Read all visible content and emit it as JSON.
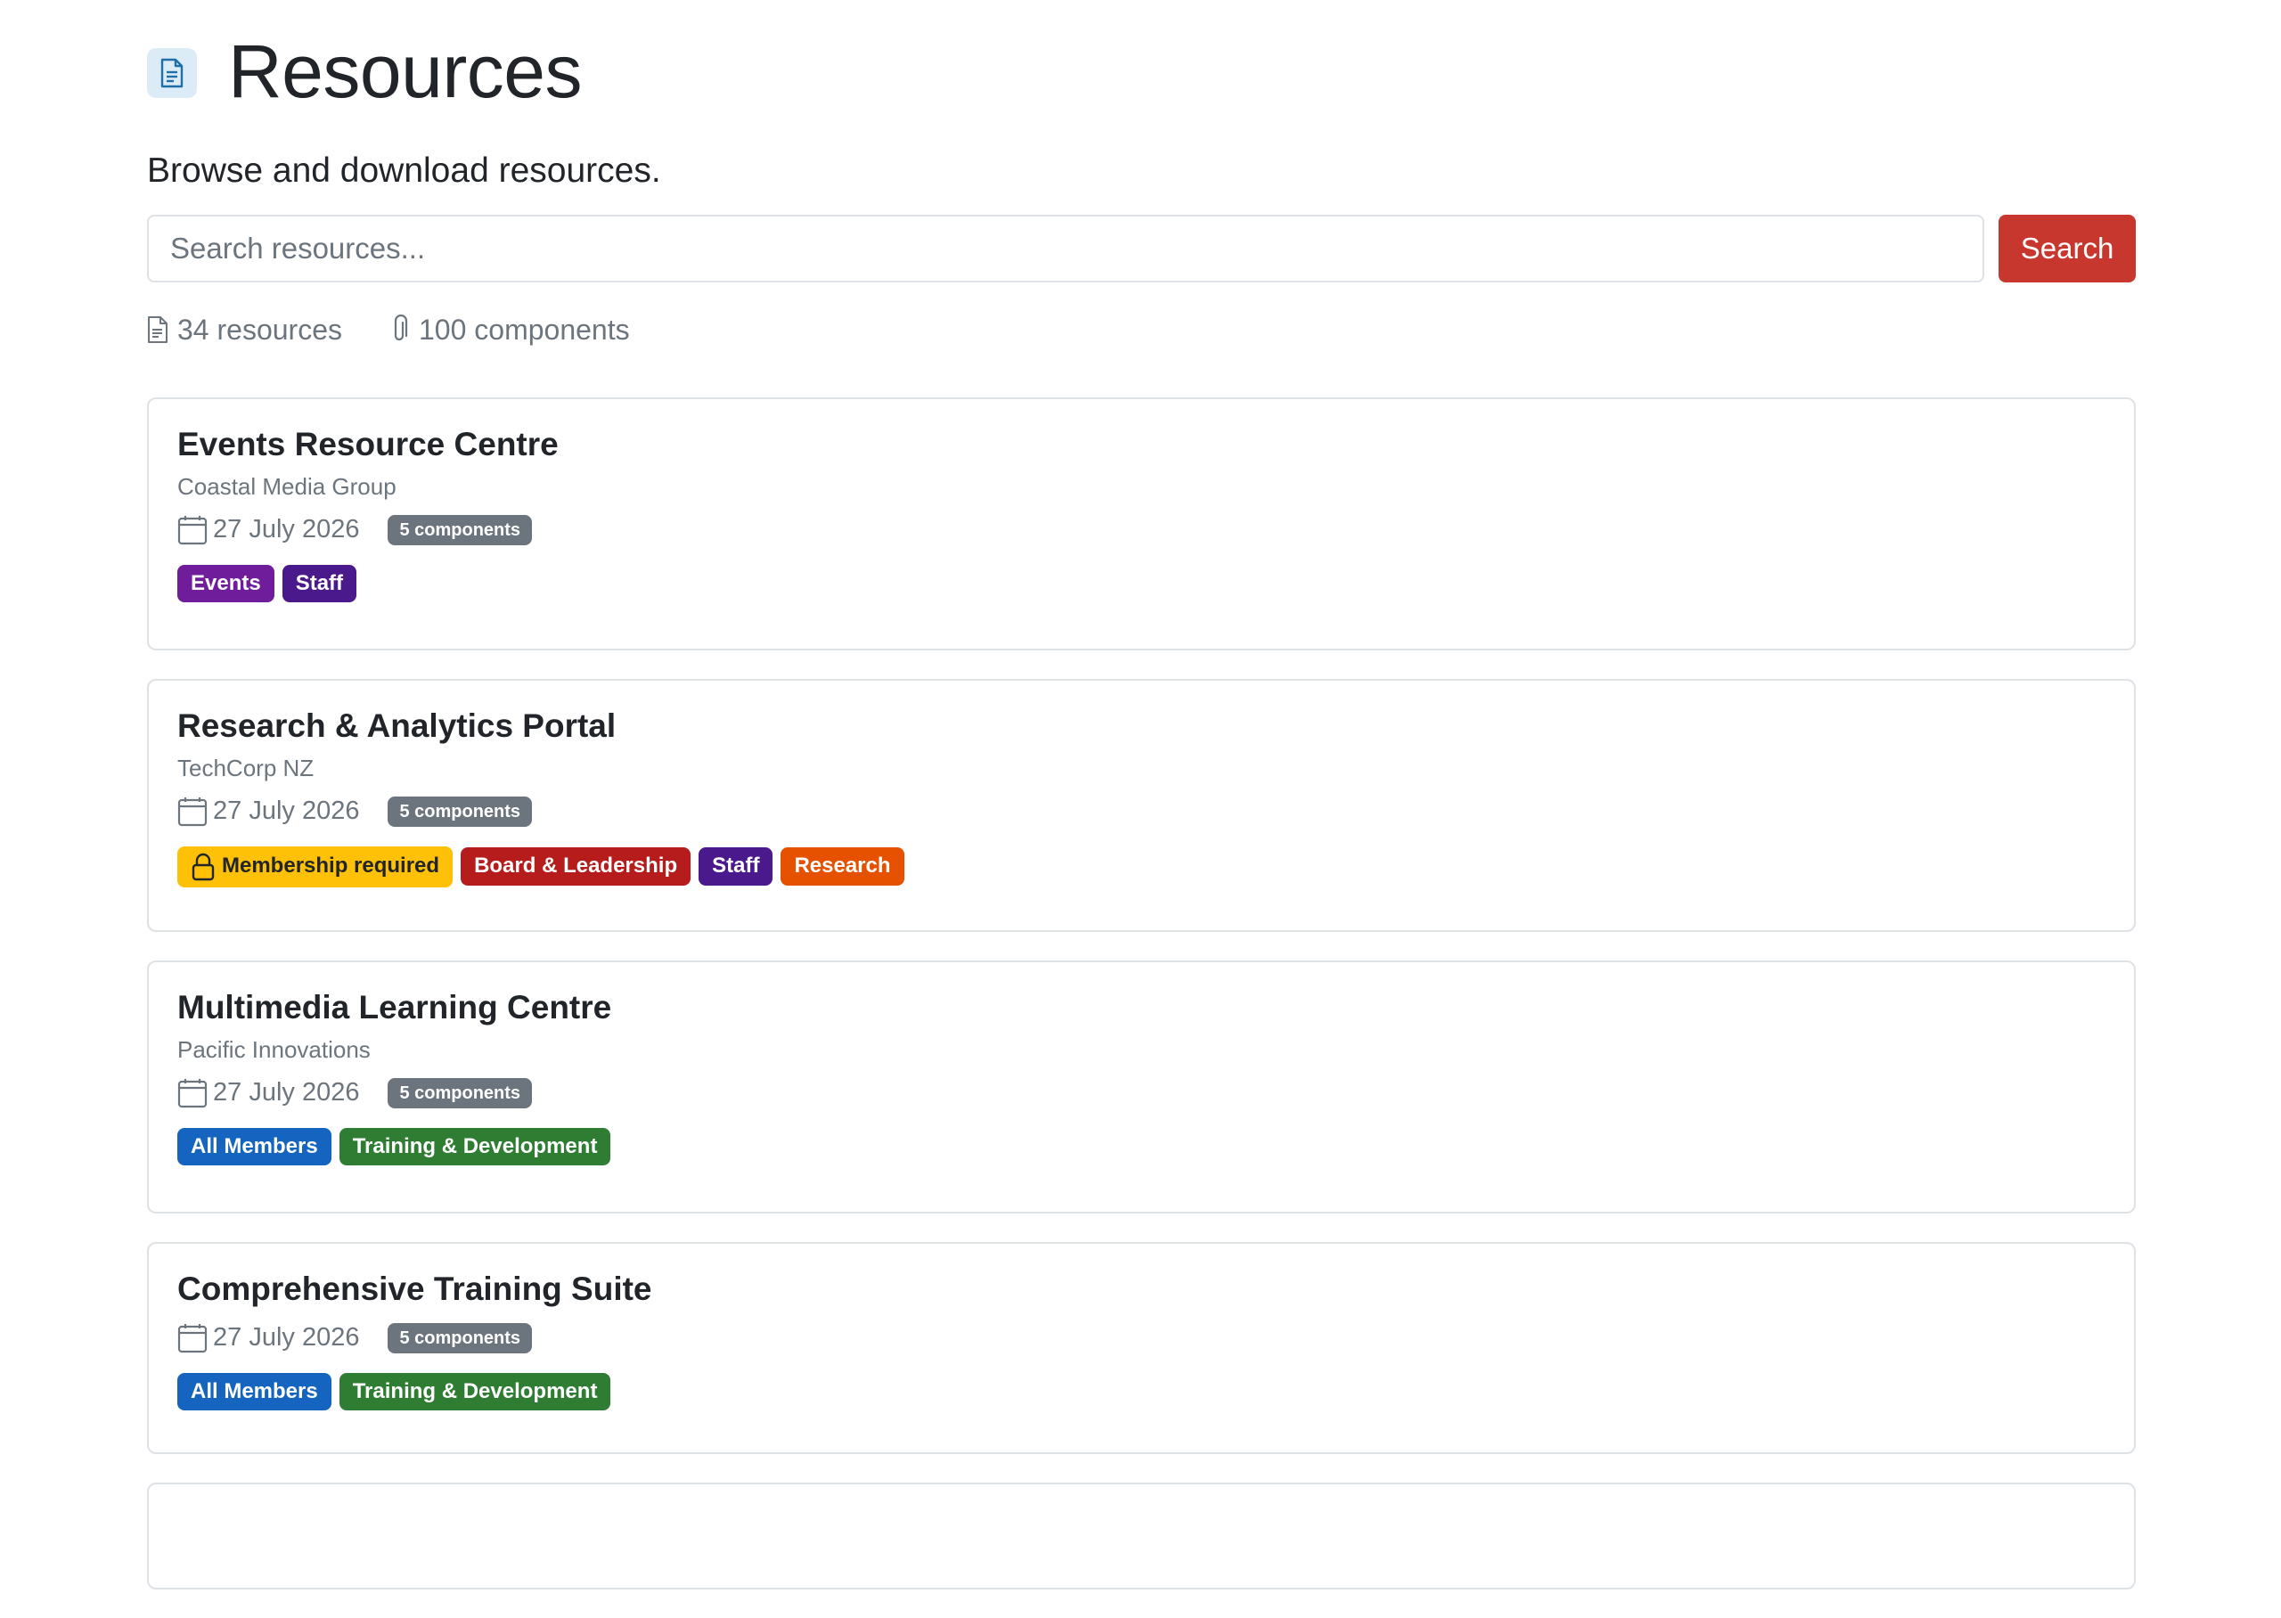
{
  "header": {
    "title": "Resources",
    "subtitle": "Browse and download resources.",
    "icon": "document-icon"
  },
  "search": {
    "placeholder": "Search resources...",
    "value": "",
    "button_label": "Search"
  },
  "stats": {
    "resources": "34 resources",
    "components": "100 components"
  },
  "colors": {
    "search_button": "#c8372d",
    "badge_grey": "#6c757d",
    "events": "#6f1d9b",
    "staff": "#4a1a8c",
    "membership": "#ffc107",
    "board": "#b71c1c",
    "research": "#e65100",
    "all_members": "#1565c0",
    "training": "#2e7d32"
  },
  "resources": [
    {
      "title": "Events Resource Centre",
      "organisation": "Coastal Media Group",
      "date": "27 July 2026",
      "components": "5 components",
      "tags": [
        {
          "label": "Events",
          "color": "#6f1d9b"
        },
        {
          "label": "Staff",
          "color": "#4a1a8c"
        }
      ]
    },
    {
      "title": "Research & Analytics Portal",
      "organisation": "TechCorp NZ",
      "date": "27 July 2026",
      "components": "5 components",
      "membership": "Membership required",
      "tags": [
        {
          "label": "Board & Leadership",
          "color": "#b71c1c"
        },
        {
          "label": "Staff",
          "color": "#4a1a8c"
        },
        {
          "label": "Research",
          "color": "#e65100"
        }
      ]
    },
    {
      "title": "Multimedia Learning Centre",
      "organisation": "Pacific Innovations",
      "date": "27 July 2026",
      "components": "5 components",
      "tags": [
        {
          "label": "All Members",
          "color": "#1565c0"
        },
        {
          "label": "Training & Development",
          "color": "#2e7d32"
        }
      ]
    },
    {
      "title": "Comprehensive Training Suite",
      "date": "27 July 2026",
      "components": "5 components",
      "tags": [
        {
          "label": "All Members",
          "color": "#1565c0"
        },
        {
          "label": "Training & Development",
          "color": "#2e7d32"
        }
      ]
    }
  ]
}
